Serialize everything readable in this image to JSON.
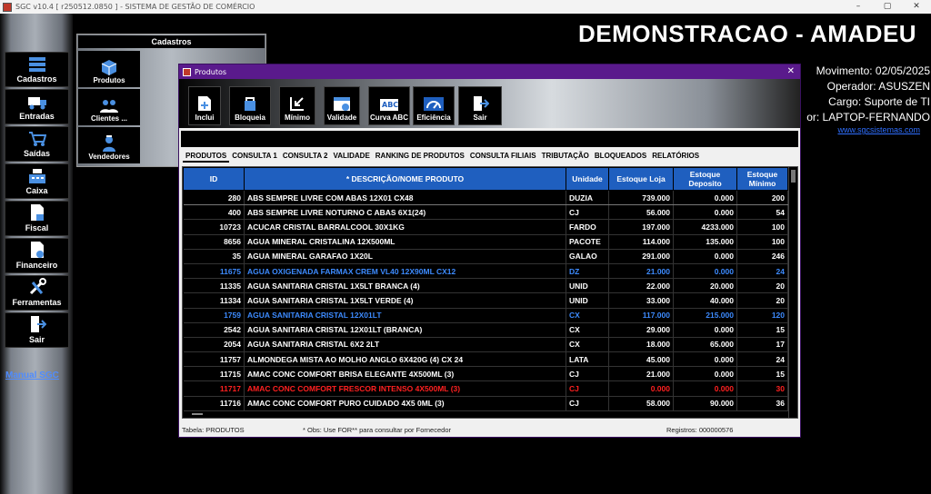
{
  "titlebar": {
    "text": "SGC v10.4 [ r250512.0850 ] - SISTEMA DE GESTÃO DE COMÉRCIO",
    "min": "–",
    "max": "▢",
    "close": "✕"
  },
  "sidebar": {
    "items": [
      {
        "label": "Cadastros",
        "icon": "stack-icon"
      },
      {
        "label": "Entradas",
        "icon": "truck-icon"
      },
      {
        "label": "Saídas",
        "icon": "cart-icon"
      },
      {
        "label": "Caixa",
        "icon": "register-icon"
      },
      {
        "label": "Fiscal",
        "icon": "document-icon"
      },
      {
        "label": "Financeiro",
        "icon": "finance-doc-icon"
      },
      {
        "label": "Ferramentas",
        "icon": "tools-icon"
      },
      {
        "label": "Sair",
        "icon": "exit-icon"
      }
    ],
    "manual_link": "Manual SGC"
  },
  "cadastros_panel": {
    "title": "Cadastros",
    "items": [
      {
        "label": "Produtos",
        "icon": "box-icon"
      },
      {
        "label": "Clientes ...",
        "icon": "people-icon"
      },
      {
        "label": "Vendedores",
        "icon": "seller-icon"
      }
    ]
  },
  "header": {
    "company": "DEMONSTRACAO - AMADEU",
    "movimento": "Movimento: 02/05/2025",
    "operador": "Operador: ASUSZEN",
    "cargo": "Cargo: Suporte de TI",
    "computador": "or: LAPTOP-FERNANDO",
    "website": "www.sgcsistemas.com"
  },
  "window": {
    "title": "Produtos",
    "close": "✕",
    "toolbar": [
      {
        "label": "Inclui",
        "icon": "add-doc-icon"
      },
      {
        "label": "Bloqueia",
        "icon": "block-icon"
      },
      {
        "label": "Mínimo",
        "icon": "minimum-icon"
      },
      {
        "label": "Validade",
        "icon": "calendar-icon"
      },
      {
        "label": "Curva ABC",
        "icon": "abc-icon"
      },
      {
        "label": "Eficiência",
        "icon": "gauge-icon"
      },
      {
        "label": "Sair",
        "icon": "exit-icon"
      }
    ],
    "tabs": [
      "PRODUTOS",
      "CONSULTA 1",
      "CONSULTA 2",
      "VALIDADE",
      "RANKING DE PRODUTOS",
      "CONSULTA FILIAIS",
      "TRIBUTAÇÃO",
      "BLOQUEADOS",
      "RELATÓRIOS"
    ],
    "columns": [
      "ID",
      "* DESCRIÇÃO/NOME PRODUTO",
      "Unidade",
      "Estoque Loja",
      "Estoque Deposito",
      "Estoque Mínimo"
    ],
    "rows": [
      {
        "id": "280",
        "desc": "ABS SEMPRE LIVRE COM ABAS 12X01  CX48",
        "un": "DUZIA",
        "loja": "739.000",
        "dep": "0.000",
        "min": "200",
        "style": "sel"
      },
      {
        "id": "400",
        "desc": "ABS SEMPRE LIVRE NOTURNO C ABAS 6X1(24)",
        "un": "CJ",
        "loja": "56.000",
        "dep": "0.000",
        "min": "54",
        "style": ""
      },
      {
        "id": "10723",
        "desc": "ACUCAR CRISTAL BARRALCOOL  30X1KG",
        "un": "FARDO",
        "loja": "197.000",
        "dep": "4233.000",
        "min": "100",
        "style": ""
      },
      {
        "id": "8656",
        "desc": "AGUA MINERAL CRISTALINA 12X500ML",
        "un": "PACOTE",
        "loja": "114.000",
        "dep": "135.000",
        "min": "100",
        "style": ""
      },
      {
        "id": "35",
        "desc": "AGUA MINERAL GARAFAO 1X20L",
        "un": "GALAO",
        "loja": "291.000",
        "dep": "0.000",
        "min": "246",
        "style": ""
      },
      {
        "id": "11675",
        "desc": "AGUA OXIGENADA FARMAX CREM VL40 12X90ML  CX12",
        "un": "DZ",
        "loja": "21.000",
        "dep": "0.000",
        "min": "24",
        "style": "blue"
      },
      {
        "id": "11335",
        "desc": "AGUA SANITARIA  CRISTAL 1X5LT BRANCA (4)",
        "un": "UNID",
        "loja": "22.000",
        "dep": "20.000",
        "min": "20",
        "style": ""
      },
      {
        "id": "11334",
        "desc": "AGUA SANITARIA  CRISTAL 1X5LT VERDE (4)",
        "un": "UNID",
        "loja": "33.000",
        "dep": "40.000",
        "min": "20",
        "style": ""
      },
      {
        "id": "1759",
        "desc": "AGUA SANITARIA CRISTAL 12X01LT",
        "un": "CX",
        "loja": "117.000",
        "dep": "215.000",
        "min": "120",
        "style": "blue"
      },
      {
        "id": "2542",
        "desc": "AGUA SANITARIA CRISTAL 12X01LT (BRANCA)",
        "un": "CX",
        "loja": "29.000",
        "dep": "0.000",
        "min": "15",
        "style": ""
      },
      {
        "id": "2054",
        "desc": "AGUA SANITARIA CRISTAL 6X2 2LT",
        "un": "CX",
        "loja": "18.000",
        "dep": "65.000",
        "min": "17",
        "style": ""
      },
      {
        "id": "11757",
        "desc": "ALMONDEGA MISTA AO MOLHO ANGLO 6X420G (4) CX 24",
        "un": "LATA",
        "loja": "45.000",
        "dep": "0.000",
        "min": "24",
        "style": ""
      },
      {
        "id": "11715",
        "desc": "AMAC CONC COMFORT BRISA ELEGANTE 4X500ML (3)",
        "un": "CJ",
        "loja": "21.000",
        "dep": "0.000",
        "min": "15",
        "style": ""
      },
      {
        "id": "11717",
        "desc": "AMAC CONC COMFORT FRESCOR INTENSO  4X500ML (3)",
        "un": "CJ",
        "loja": "0.000",
        "dep": "0.000",
        "min": "30",
        "style": "red"
      },
      {
        "id": "11716",
        "desc": "AMAC CONC COMFORT PURO CUIDADO  4X5 0ML (3)",
        "un": "CJ",
        "loja": "58.000",
        "dep": "90.000",
        "min": "36",
        "style": ""
      }
    ],
    "status": {
      "tabela": "Tabela: PRODUTOS",
      "obs": "* Obs: Use FOR** para consultar por Fornecedor",
      "registros": "Registros: 000000576"
    }
  }
}
